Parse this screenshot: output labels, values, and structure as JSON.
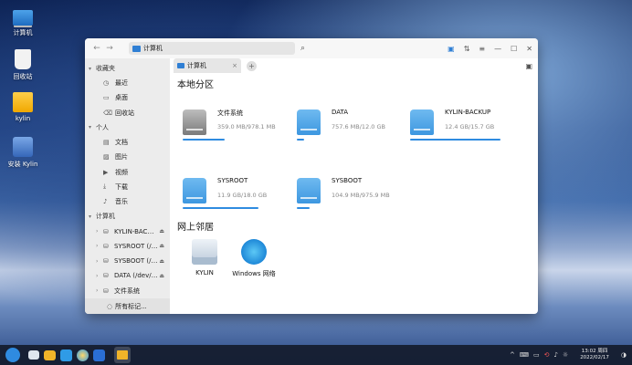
{
  "desktop": {
    "icons": [
      {
        "label": "计算机",
        "icon": "computer-icon"
      },
      {
        "label": "回收站",
        "icon": "trash-icon"
      },
      {
        "label": "kylin",
        "icon": "home-folder-icon"
      },
      {
        "label": "安装 Kylin",
        "icon": "installer-icon"
      }
    ]
  },
  "window": {
    "path": "计算机",
    "tab_label": "计算机",
    "nav": {
      "back": "←",
      "forward": "→",
      "search": "⌕"
    },
    "toolbar": {
      "view": "▣",
      "sort": "⇅",
      "menu": "≡",
      "min": "—",
      "max": "☐",
      "close": "✕"
    }
  },
  "sidebar": {
    "favorites": {
      "title": "收藏夹",
      "items": [
        {
          "label": "最近",
          "icon": "clock-icon",
          "glyph": "◷"
        },
        {
          "label": "桌面",
          "icon": "desktop-icon",
          "glyph": "▭"
        },
        {
          "label": "回收站",
          "icon": "trash-icon",
          "glyph": "⌫"
        }
      ]
    },
    "personal": {
      "title": "个人",
      "items": [
        {
          "label": "文档",
          "icon": "document-icon",
          "glyph": "▤"
        },
        {
          "label": "图片",
          "icon": "picture-icon",
          "glyph": "▨"
        },
        {
          "label": "视频",
          "icon": "video-icon",
          "glyph": "▶"
        },
        {
          "label": "下载",
          "icon": "download-icon",
          "glyph": "⤓"
        },
        {
          "label": "音乐",
          "icon": "music-icon",
          "glyph": "♪"
        }
      ]
    },
    "computer": {
      "title": "计算机",
      "items": [
        {
          "label": "KYLIN-BAC…",
          "eject": true
        },
        {
          "label": "SYSROOT (/…",
          "eject": true
        },
        {
          "label": "SYSBOOT (/…",
          "eject": true
        },
        {
          "label": "DATA (/dev/…",
          "eject": true
        },
        {
          "label": "文件系统",
          "eject": false
        }
      ]
    },
    "more": "所有标记..."
  },
  "main": {
    "local_title": "本地分区",
    "drives": [
      {
        "name": "文件系统",
        "size": "359.0 MB/978.1 MB",
        "usage": 0.37,
        "color": "#8c8c8c"
      },
      {
        "name": "DATA",
        "size": "757.6 MB/12.0 GB",
        "usage": 0.06,
        "color": "#3d97e0"
      },
      {
        "name": "KYLIN-BACKUP",
        "size": "12.4 GB/15.7 GB",
        "usage": 0.79,
        "color": "#3d97e0"
      },
      {
        "name": "SYSROOT",
        "size": "11.9 GB/18.0 GB",
        "usage": 0.66,
        "color": "#3d97e0"
      },
      {
        "name": "SYSBOOT",
        "size": "104.9 MB/975.9 MB",
        "usage": 0.11,
        "color": "#3d97e0"
      }
    ],
    "network_title": "网上邻居",
    "network": [
      {
        "label": "KYLIN",
        "icon": "server-stack-icon"
      },
      {
        "label": "Windows 网络",
        "icon": "network-globe-icon"
      }
    ]
  },
  "taskbar": {
    "apps": [
      "start-menu-icon",
      "window-switch-icon",
      "file-manager-icon",
      "app-store-icon",
      "browser-icon",
      "wps-icon",
      "file-manager-active-icon"
    ],
    "time": "13:02 周四",
    "date": "2022/02/17",
    "tray": [
      "^",
      "⌨",
      "▭",
      "⟲",
      "♪",
      "☼"
    ]
  }
}
